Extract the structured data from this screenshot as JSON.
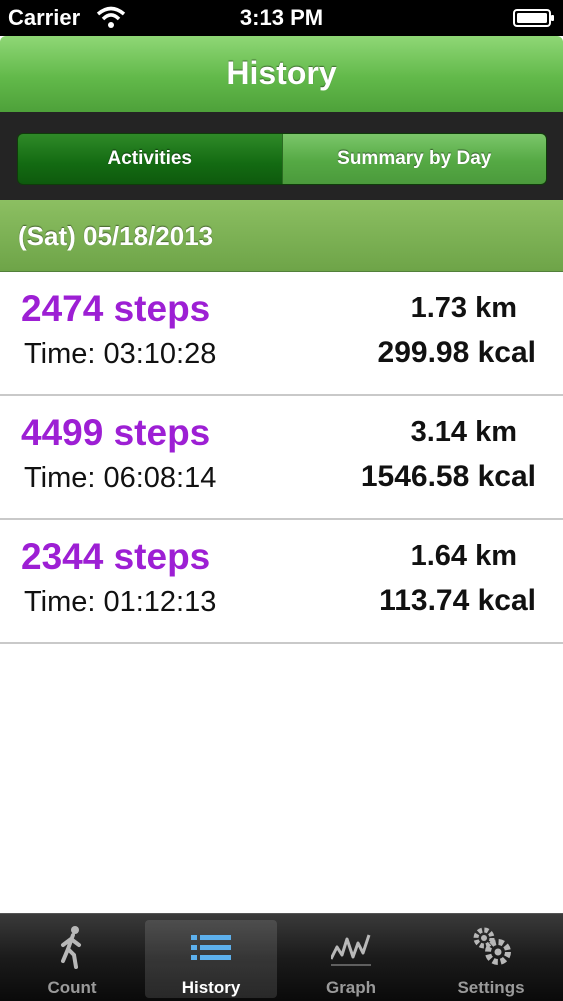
{
  "status_bar": {
    "carrier": "Carrier",
    "time": "3:13 PM"
  },
  "navbar": {
    "title": "History"
  },
  "segments": {
    "activities": "Activities",
    "summary": "Summary by Day"
  },
  "date_header": {
    "date": "(Sat) 05/18/2013"
  },
  "rows": [
    {
      "steps": "2474 steps",
      "time": "Time: 03:10:28",
      "distance": "1.73 km",
      "kcal": "299.98 kcal"
    },
    {
      "steps": "4499 steps",
      "time": "Time: 06:08:14",
      "distance": "3.14 km",
      "kcal": "1546.58 kcal"
    },
    {
      "steps": "2344 steps",
      "time": "Time: 01:12:13",
      "distance": "1.64 km",
      "kcal": "113.74 kcal"
    }
  ],
  "tabs": [
    {
      "label": "Count",
      "icon": "walker-icon"
    },
    {
      "label": "History",
      "icon": "list-icon"
    },
    {
      "label": "Graph",
      "icon": "graph-icon"
    },
    {
      "label": "Settings",
      "icon": "gears-icon"
    }
  ],
  "colors": {
    "accent_green": "#62b94a",
    "steps_purple": "#9d1fd4"
  }
}
